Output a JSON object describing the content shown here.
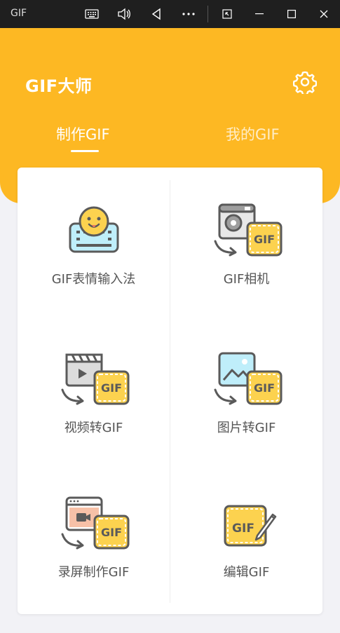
{
  "window": {
    "app_label": "GIF",
    "buttons": [
      "keyboard-icon",
      "speaker-icon",
      "back-icon",
      "more-icon",
      "restore-icon",
      "minimize-icon",
      "maximize-icon",
      "close-icon"
    ]
  },
  "header": {
    "title": "GIF大师",
    "tabs": [
      {
        "label": "制作GIF",
        "active": true
      },
      {
        "label": "我的GIF",
        "active": false
      }
    ]
  },
  "tools": [
    {
      "label": "GIF表情输入法",
      "icon": "emoji-keyboard-icon"
    },
    {
      "label": "GIF相机",
      "icon": "camera-gif-icon"
    },
    {
      "label": "视频转GIF",
      "icon": "video-to-gif-icon"
    },
    {
      "label": "图片转GIF",
      "icon": "image-to-gif-icon"
    },
    {
      "label": "录屏制作GIF",
      "icon": "screen-record-gif-icon"
    },
    {
      "label": "编辑GIF",
      "icon": "edit-gif-icon"
    }
  ],
  "colors": {
    "accent": "#fdb823",
    "gif_badge": "#fcd24f",
    "outline": "#5a5a5a"
  },
  "badge_text": "GIF"
}
